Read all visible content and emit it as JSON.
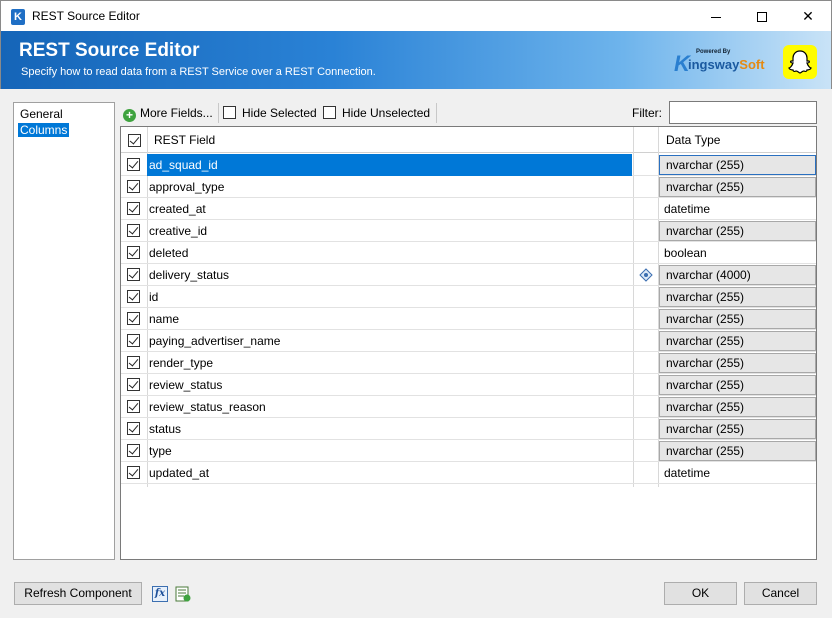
{
  "window": {
    "title": "REST Source Editor",
    "app_icon_letter": "K"
  },
  "banner": {
    "title": "REST Source Editor",
    "subtitle": "Specify how to read data from a REST Service over a REST Connection.",
    "logo_powered": "Powered By",
    "logo_k": "K",
    "logo_name_a": "ingsway",
    "logo_name_b": "Soft",
    "brand_icon": "snapchat-ghost-icon"
  },
  "nav": {
    "items": [
      {
        "label": "General"
      },
      {
        "label": "Columns",
        "selected": true
      }
    ]
  },
  "toolbar": {
    "more_fields_label": "More Fields...",
    "hide_selected_label": "Hide Selected",
    "hide_unselected_label": "Hide Unselected",
    "filter_label": "Filter:",
    "filter_value": ""
  },
  "grid": {
    "headers": {
      "field": "REST Field",
      "type": "Data Type"
    },
    "rows": [
      {
        "field": "ad_squad_id",
        "type": "nvarchar (255)",
        "checked": true,
        "selected": true,
        "type_boxed": true,
        "note_icon": false
      },
      {
        "field": "approval_type",
        "type": "nvarchar (255)",
        "checked": true,
        "type_boxed": true,
        "note_icon": false
      },
      {
        "field": "created_at",
        "type": "datetime",
        "checked": true,
        "type_boxed": false,
        "note_icon": false
      },
      {
        "field": "creative_id",
        "type": "nvarchar (255)",
        "checked": true,
        "type_boxed": true,
        "note_icon": false
      },
      {
        "field": "deleted",
        "type": "boolean",
        "checked": true,
        "type_boxed": false,
        "note_icon": false
      },
      {
        "field": "delivery_status",
        "type": "nvarchar (4000)",
        "checked": true,
        "type_boxed": true,
        "note_icon": true
      },
      {
        "field": "id",
        "type": "nvarchar (255)",
        "checked": true,
        "type_boxed": true,
        "note_icon": false
      },
      {
        "field": "name",
        "type": "nvarchar (255)",
        "checked": true,
        "type_boxed": true,
        "note_icon": false
      },
      {
        "field": "paying_advertiser_name",
        "type": "nvarchar (255)",
        "checked": true,
        "type_boxed": true,
        "note_icon": false
      },
      {
        "field": "render_type",
        "type": "nvarchar (255)",
        "checked": true,
        "type_boxed": true,
        "note_icon": false
      },
      {
        "field": "review_status",
        "type": "nvarchar (255)",
        "checked": true,
        "type_boxed": true,
        "note_icon": false
      },
      {
        "field": "review_status_reason",
        "type": "nvarchar (255)",
        "checked": true,
        "type_boxed": true,
        "note_icon": false
      },
      {
        "field": "status",
        "type": "nvarchar (255)",
        "checked": true,
        "type_boxed": true,
        "note_icon": false
      },
      {
        "field": "type",
        "type": "nvarchar (255)",
        "checked": true,
        "type_boxed": true,
        "note_icon": false
      },
      {
        "field": "updated_at",
        "type": "datetime",
        "checked": true,
        "type_boxed": false,
        "note_icon": false
      }
    ]
  },
  "footer": {
    "refresh_label": "Refresh Component",
    "fx_label": "fx",
    "ok_label": "OK",
    "cancel_label": "Cancel"
  },
  "colors": {
    "selection": "#0078d7",
    "banner_start": "#1565b8",
    "banner_end": "#c9e3f7",
    "snapchat_yellow": "#fffc00"
  }
}
